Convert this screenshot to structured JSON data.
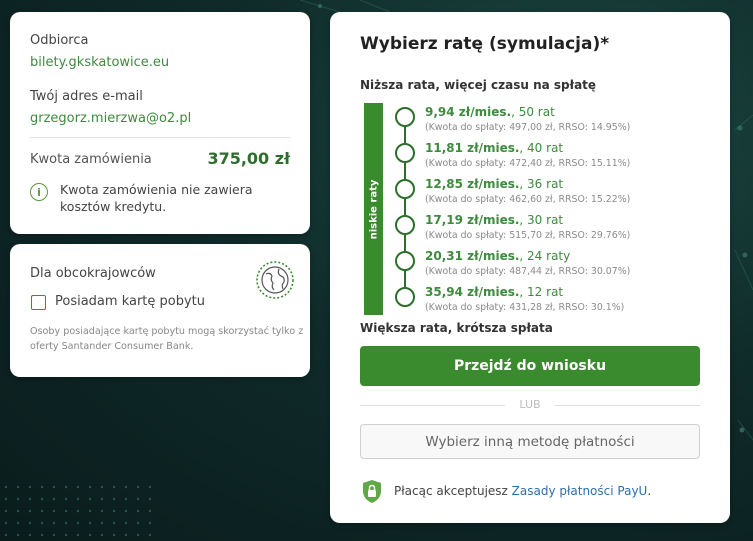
{
  "order": {
    "recipient_label": "Odbiorca",
    "recipient_value": "bilety.gkskatowice.eu",
    "email_label": "Twój adres e-mail",
    "email_value": "grzegorz.mierzwa@o2.pl",
    "amount_label": "Kwota zamówienia",
    "amount_value": "375,00 zł",
    "info_text": "Kwota zamówienia nie zawiera kosztów kredytu."
  },
  "foreign": {
    "title": "Dla obcokrajowców",
    "checkbox_label": "Posiadam kartę pobytu",
    "note": "Osoby posiadające kartę pobytu mogą skorzystać tylko z oferty Santander Consumer Bank."
  },
  "plan": {
    "title": "Wybierz ratę (symulacja)*",
    "lower_label": "Niższa rata, więcej czasu na spłatę",
    "higher_label": "Większa rata, krótsza spłata",
    "side_label": "niskie raty",
    "options": [
      {
        "amount": "9,94 zł/mies.",
        "count": ", 50 rat",
        "detail": "(Kwota do spłaty: 497,00 zł, RRSO: 14.95%)"
      },
      {
        "amount": "11,81 zł/mies.",
        "count": ", 40 rat",
        "detail": "(Kwota do spłaty: 472,40 zł, RRSO: 15.11%)"
      },
      {
        "amount": "12,85 zł/mies.",
        "count": ", 36 rat",
        "detail": "(Kwota do spłaty: 462,60 zł, RRSO: 15.22%)"
      },
      {
        "amount": "17,19 zł/mies.",
        "count": ", 30 rat",
        "detail": "(Kwota do spłaty: 515,70 zł, RRSO: 29.76%)"
      },
      {
        "amount": "20,31 zł/mies.",
        "count": ", 24 raty",
        "detail": "(Kwota do spłaty: 487,44 zł, RRSO: 30.07%)"
      },
      {
        "amount": "35,94 zł/mies.",
        "count": ", 12 rat",
        "detail": "(Kwota do spłaty: 431,28 zł, RRSO: 30.1%)"
      }
    ],
    "primary_button": "Przejdź do wniosku",
    "or_text": "LUB",
    "secondary_button": "Wybierz inną metodę płatności",
    "terms_prefix": "Płacąc akceptujesz ",
    "terms_link": "Zasady płatności PayU",
    "terms_suffix": "."
  },
  "colors": {
    "accent": "#3a8a2e",
    "link": "#2f6fa8",
    "background": "#0f2b2a"
  }
}
